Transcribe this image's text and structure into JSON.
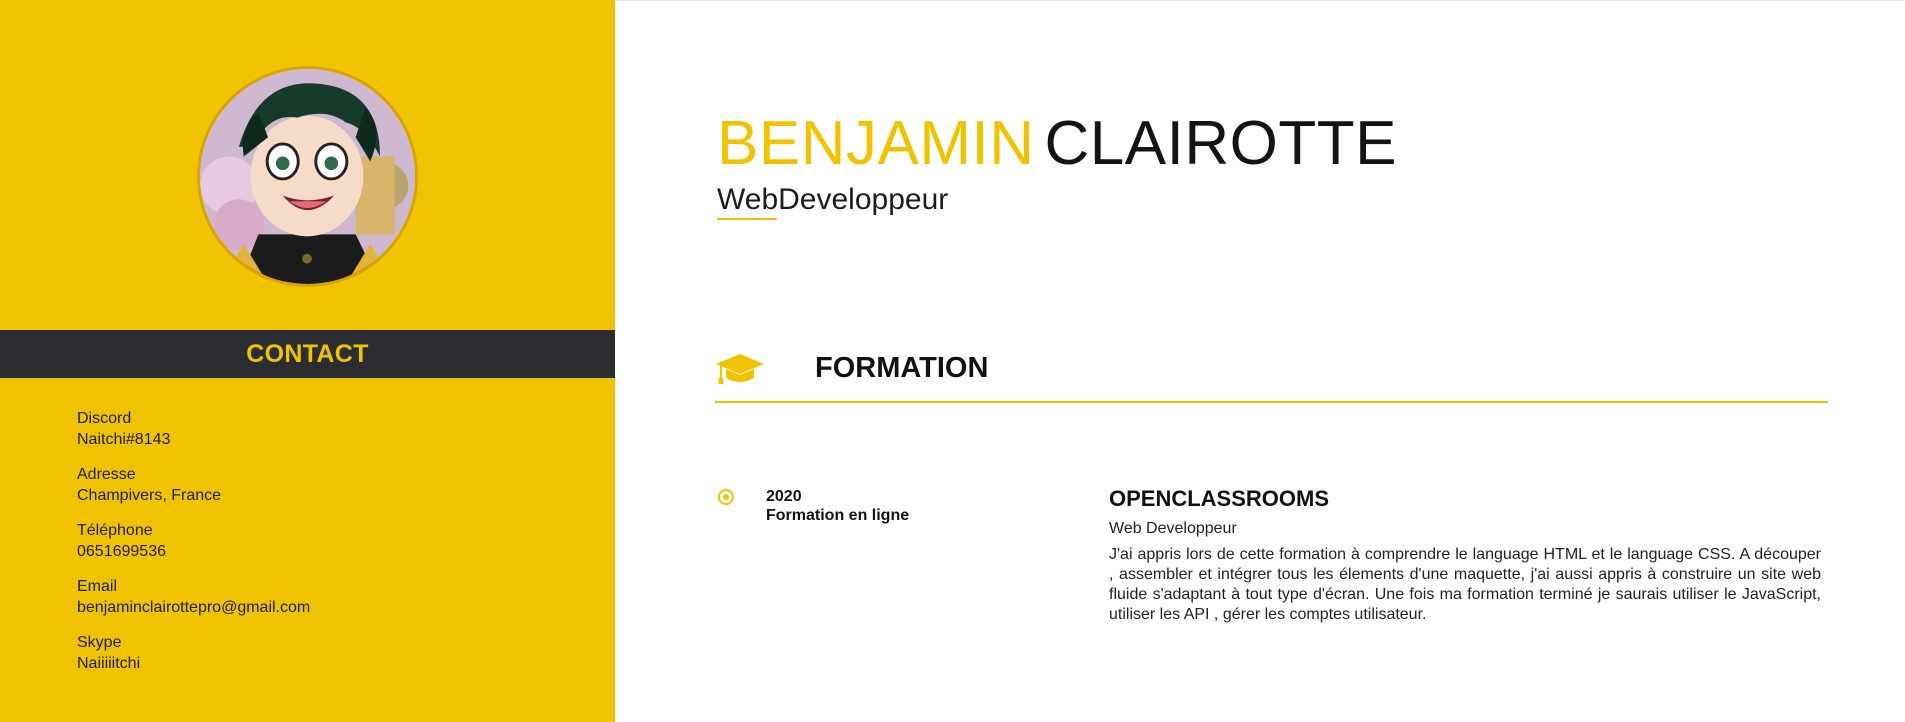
{
  "sidebar": {
    "contact_title": "CONTACT",
    "contacts": [
      {
        "label": "Discord",
        "value": "Naitchi#8143"
      },
      {
        "label": "Adresse",
        "value": "Champivers, France"
      },
      {
        "label": "Téléphone",
        "value": "0651699536"
      },
      {
        "label": "Email",
        "value": "benjaminclairottepro@gmail.com"
      },
      {
        "label": "Skype",
        "value": "Naiiiiitchi"
      }
    ]
  },
  "header": {
    "first_name": "BENJAMIN",
    "last_name": "CLAIROTTE",
    "job_title": "WebDeveloppeur"
  },
  "formation": {
    "icon": "graduation-cap-icon",
    "title": "FORMATION",
    "entries": [
      {
        "year": "2020",
        "type": "Formation en ligne",
        "school": "OPENCLASSROOMS",
        "role": "Web Developpeur",
        "description": "J'ai appris lors de cette formation à comprendre le language HTML et le language CSS. A découper , assembler et intégrer tous les élements d'une maquette, j'ai aussi appris à construire un site web fluide s'adaptant à tout type d'écran. Une fois ma formation terminé je saurais utiliser le JavaScript, utiliser les API , gérer les comptes utilisateur."
      }
    ]
  },
  "colors": {
    "accent": "#f0c300",
    "dark_bar": "#2b2d30",
    "text": "#141414"
  }
}
